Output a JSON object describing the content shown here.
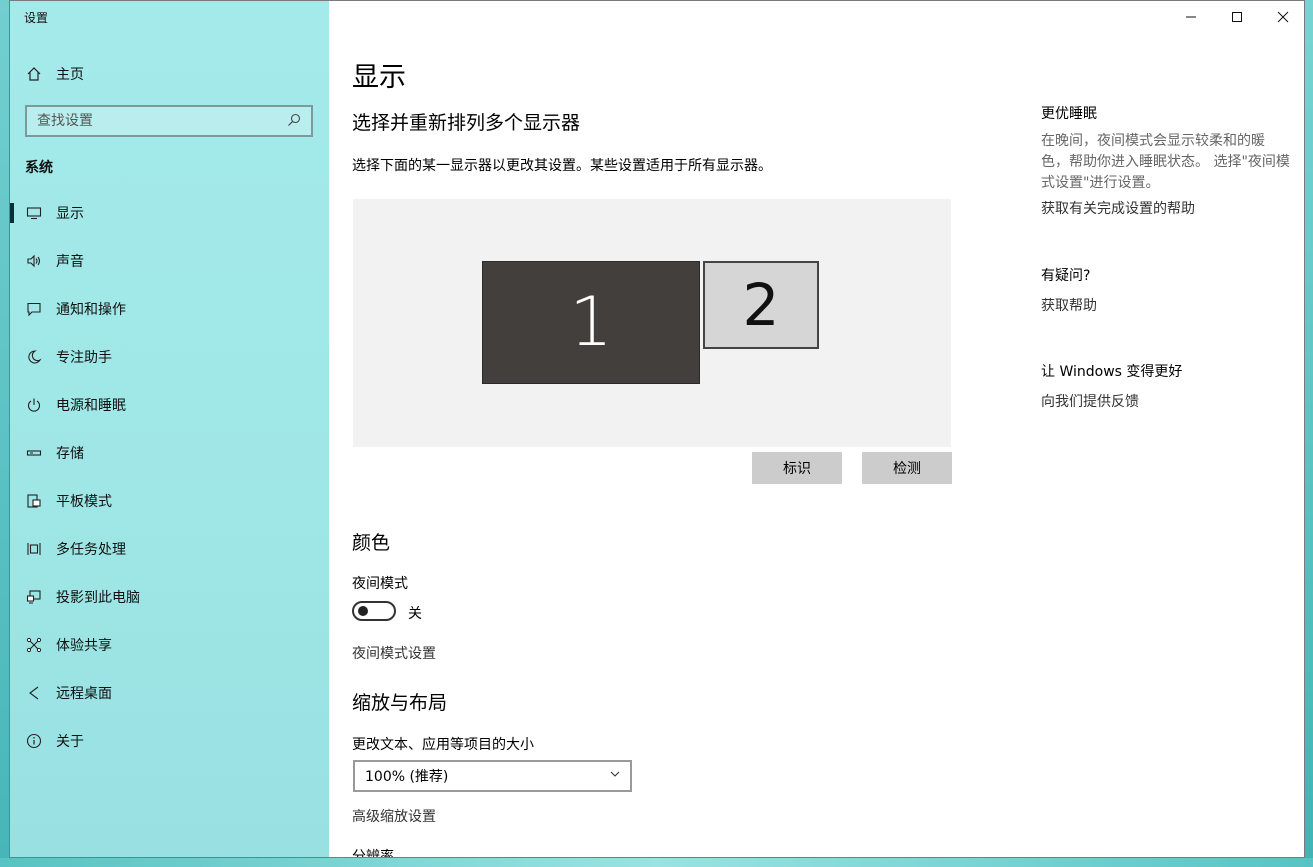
{
  "window": {
    "app_title": "设置",
    "controls": {
      "minimize": "—",
      "maximize": "☐",
      "close": "✕"
    }
  },
  "sidebar": {
    "home_label": "主页",
    "search_placeholder": "查找设置",
    "section_label": "系统",
    "items": [
      {
        "label": "显示",
        "icon": "monitor-icon",
        "active": true
      },
      {
        "label": "声音",
        "icon": "speaker-icon"
      },
      {
        "label": "通知和操作",
        "icon": "notification-icon"
      },
      {
        "label": "专注助手",
        "icon": "moon-icon"
      },
      {
        "label": "电源和睡眠",
        "icon": "power-icon"
      },
      {
        "label": "存储",
        "icon": "storage-icon"
      },
      {
        "label": "平板模式",
        "icon": "tablet-icon"
      },
      {
        "label": "多任务处理",
        "icon": "multitask-icon"
      },
      {
        "label": "投影到此电脑",
        "icon": "project-icon"
      },
      {
        "label": "体验共享",
        "icon": "share-icon"
      },
      {
        "label": "远程桌面",
        "icon": "remote-icon"
      },
      {
        "label": "关于",
        "icon": "info-icon"
      }
    ]
  },
  "main": {
    "title": "显示",
    "subtitle": "选择并重新排列多个显示器",
    "description": "选择下面的某一显示器以更改其设置。某些设置适用于所有显示器。",
    "monitors": {
      "m1": "1",
      "m2": "2"
    },
    "identify_button": "标识",
    "detect_button": "检测",
    "color_heading": "颜色",
    "night_mode_label": "夜间模式",
    "night_mode_state": "关",
    "night_mode_settings_link": "夜间模式设置",
    "scale_heading": "缩放与布局",
    "scale_label": "更改文本、应用等项目的大小",
    "scale_value": "100% (推荐)",
    "advanced_scale_link": "高级缩放设置",
    "resolution_label": "分辨率"
  },
  "aside": {
    "sleep_heading": "更优睡眠",
    "sleep_text": "在晚间，夜间模式会显示较柔和的暖色，帮助你进入睡眠状态。 选择\"夜间模式设置\"进行设置。",
    "sleep_link": "获取有关完成设置的帮助",
    "question_heading": "有疑问?",
    "question_link": "获取帮助",
    "feedback_heading": "让 Windows 变得更好",
    "feedback_link": "向我们提供反馈"
  },
  "colors": {
    "sidebar_bg": "#a4eaea",
    "monitor_selected": "#423f3d",
    "monitor_other": "#d6d6d6",
    "button_bg": "#cccccc"
  }
}
